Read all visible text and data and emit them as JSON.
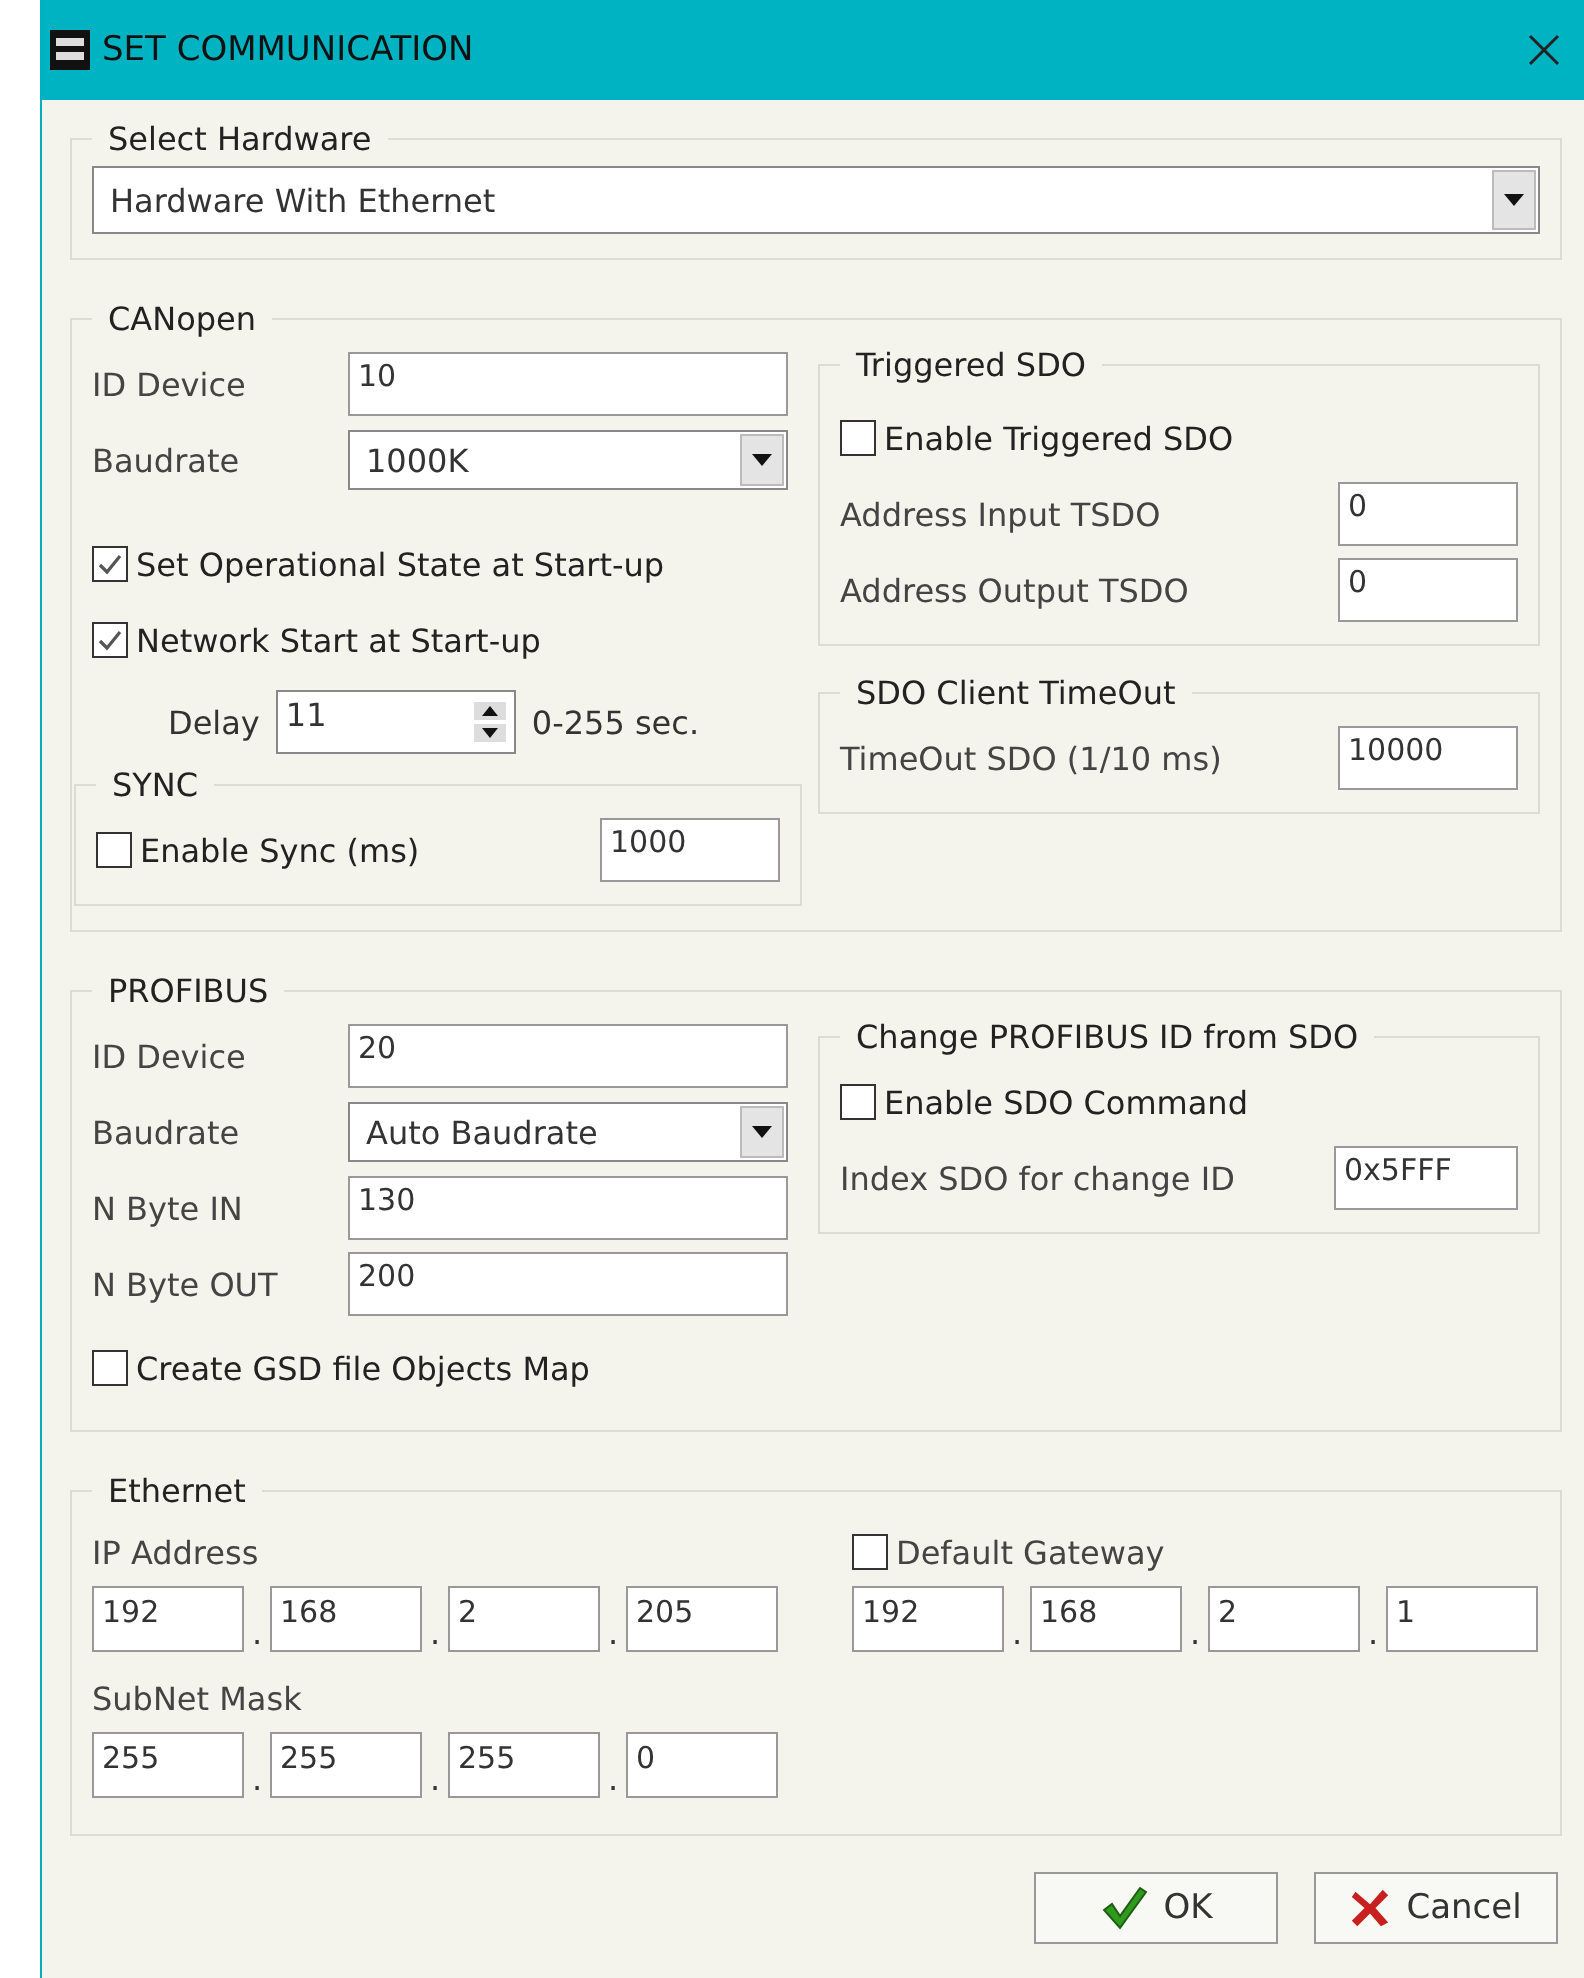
{
  "window": {
    "title": "SET COMMUNICATION"
  },
  "select_hardware": {
    "title": "Select Hardware",
    "value": "Hardware With Ethernet"
  },
  "canopen": {
    "title": "CANopen",
    "fields": [
      {
        "kind": "text",
        "label": "ID Device",
        "value": "10"
      },
      {
        "kind": "dropdown",
        "label": "Baudrate",
        "value": "1000K"
      }
    ],
    "options": [
      {
        "label": "Set Operational State at Start-up",
        "checked": true
      },
      {
        "label": "Network Start at Start-up",
        "checked": true
      }
    ],
    "delay": {
      "label": "Delay",
      "value": "11",
      "unit": "0-255 sec."
    },
    "sync": {
      "title": "SYNC",
      "label": "Enable Sync (ms)",
      "checked": false,
      "value": "1000"
    },
    "triggered_sdo": {
      "title": "Triggered SDO",
      "label": "Enable Triggered SDO",
      "checked": false,
      "fields": [
        {
          "label": "Address Input TSDO",
          "value": "0"
        },
        {
          "label": "Address Output TSDO",
          "value": "0"
        }
      ]
    },
    "sdo_client_timeout": {
      "title": "SDO Client TimeOut",
      "fields": [
        {
          "label": "TimeOut SDO (1/10 ms)",
          "value": "10000"
        }
      ]
    }
  },
  "profibus": {
    "title": "PROFIBUS",
    "fields": [
      {
        "kind": "text",
        "label": "ID Device",
        "value": "20"
      },
      {
        "kind": "dropdown",
        "label": "Baudrate",
        "value": "Auto Baudrate"
      },
      {
        "kind": "text",
        "label": "N Byte IN",
        "value": "130"
      },
      {
        "kind": "text",
        "label": "N Byte OUT",
        "value": "200"
      }
    ],
    "create_gsd": {
      "label": "Create GSD file Objects Map",
      "checked": false
    },
    "change_id": {
      "title": "Change PROFIBUS ID from SDO",
      "label": "Enable SDO Command",
      "checked": false,
      "fields": [
        {
          "label": "Index SDO for change ID",
          "value": "0x5FFF"
        }
      ]
    }
  },
  "ethernet": {
    "title": "Ethernet",
    "ip_address": {
      "label": "IP Address",
      "parts": [
        "192",
        ".",
        "168",
        ".",
        "2",
        ".",
        "205"
      ]
    },
    "default_gateway": {
      "label": "Default Gateway",
      "checked": false,
      "parts": [
        "192",
        ".",
        "168",
        ".",
        "2",
        ".",
        "1"
      ]
    },
    "subnet_mask": {
      "label": "SubNet Mask",
      "parts": [
        "255",
        ".",
        "255",
        ".",
        "255",
        ".",
        "0"
      ]
    }
  },
  "buttons": [
    {
      "kind": "ok",
      "label": "OK"
    },
    {
      "kind": "cancel",
      "label": "Cancel"
    }
  ]
}
